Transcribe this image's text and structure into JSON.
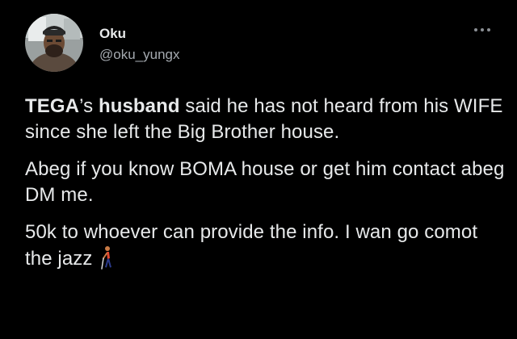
{
  "author": {
    "name": "Oku",
    "handle": "@oku_yungx",
    "avatar_icon": "profile-photo",
    "more_icon": "more-options-icon"
  },
  "tweet": {
    "p1": {
      "s1": "TEGA",
      "s2": "’s ",
      "s3": "husband",
      "s4": " said he has not heard from his WIFE since she left the Big Brother house."
    },
    "p2": "Abeg if you know BOMA house or get him contact abeg DM me.",
    "p3": "50k to whoever can provide the info. I wan go comot the jazz",
    "emoji": "person-walking-with-cane"
  },
  "colors": {
    "background": "#000000",
    "text": "#e7e9ea",
    "secondary_text": "#a5aab0"
  }
}
